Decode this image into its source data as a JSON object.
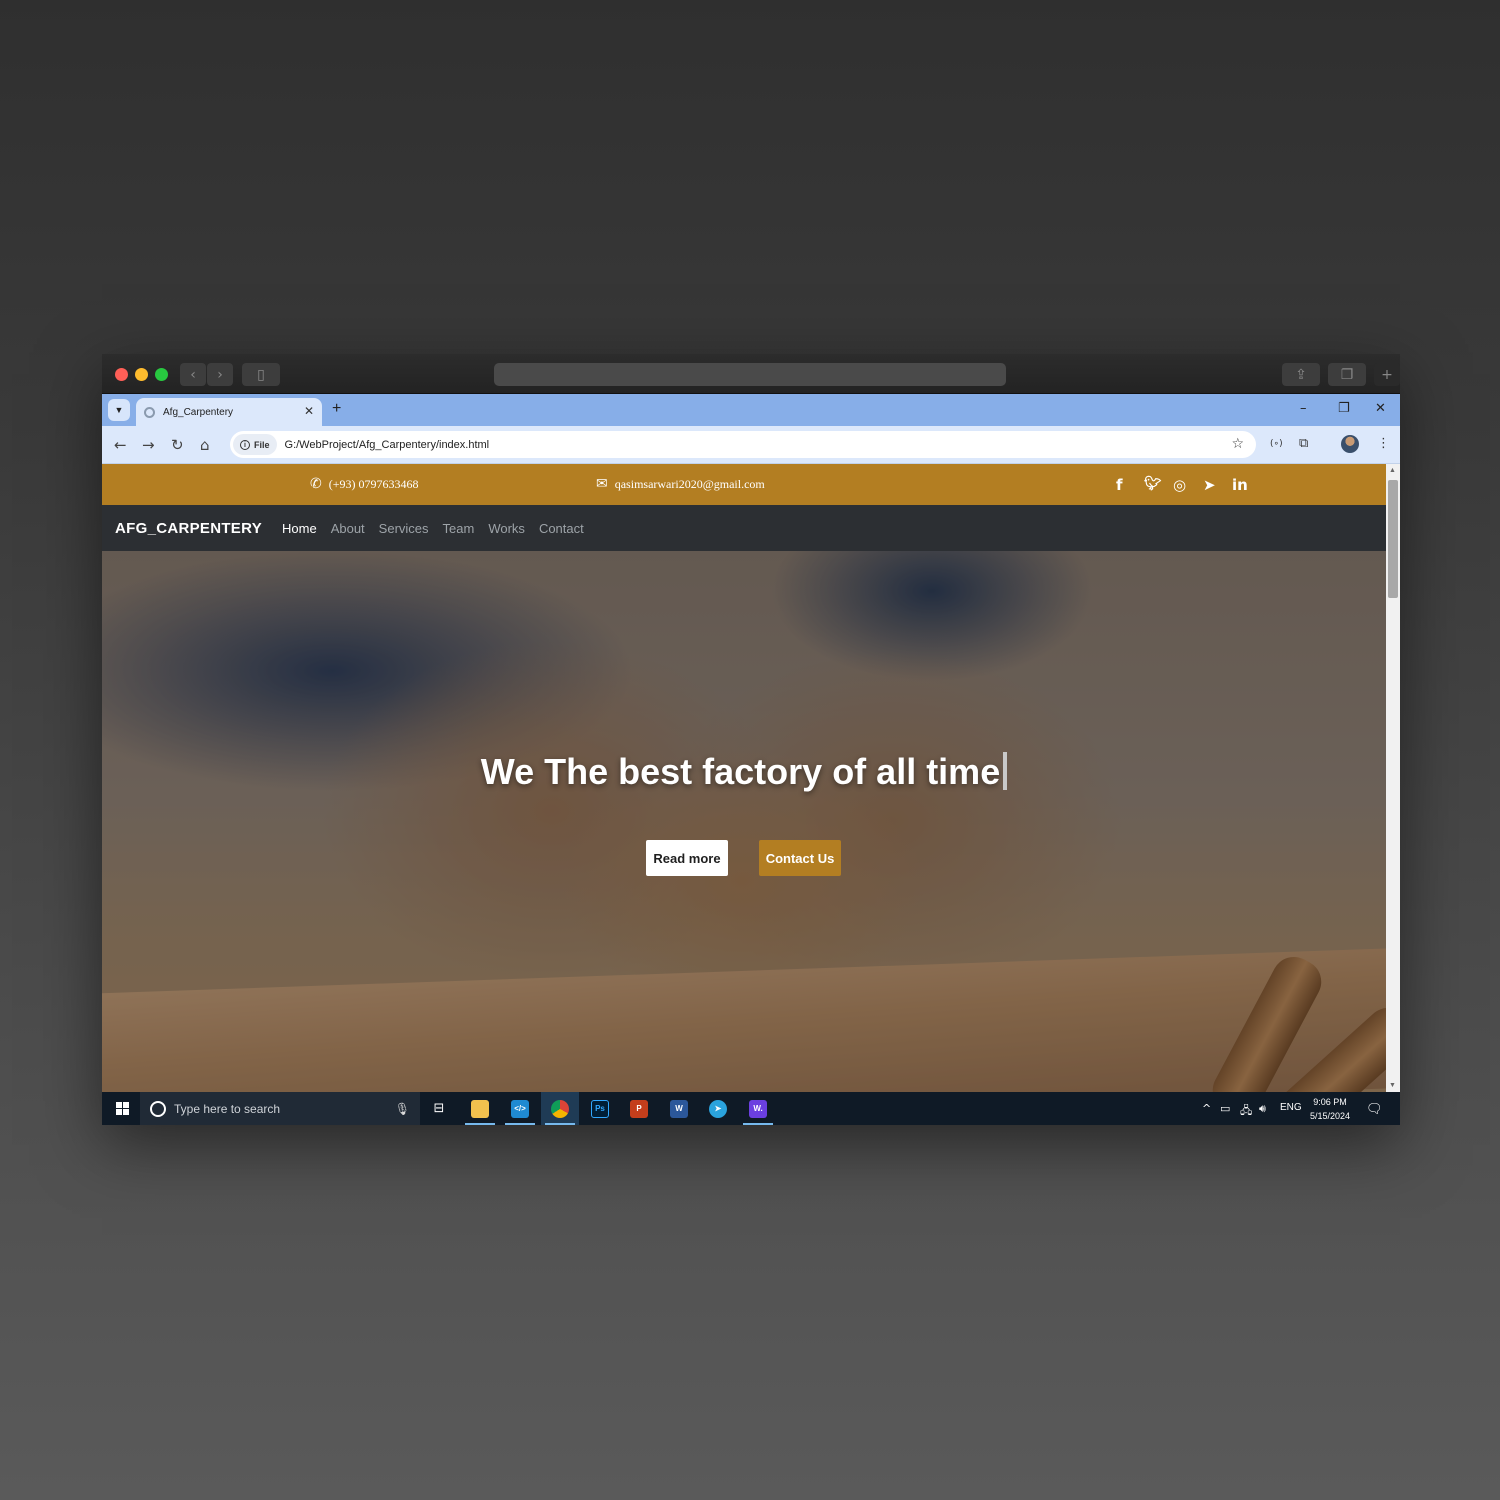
{
  "browser": {
    "tab_title": "Afg_Carpentery",
    "url_chip": "File",
    "url": "G:/WebProject/Afg_Carpentery/index.html"
  },
  "site": {
    "phone": "(+93) 0797633468",
    "email": "qasimsarwari2020@gmail.com",
    "social_icons": [
      "facebook-icon",
      "twitter-icon",
      "instagram-icon",
      "telegram-icon",
      "linkedin-icon"
    ],
    "brand": "AFG_CARPENTERY",
    "nav": [
      {
        "label": "Home",
        "active": true
      },
      {
        "label": "About",
        "active": false
      },
      {
        "label": "Services",
        "active": false
      },
      {
        "label": "Team",
        "active": false
      },
      {
        "label": "Works",
        "active": false
      },
      {
        "label": "Contact",
        "active": false
      }
    ],
    "hero_title": "We The best factory of all time",
    "read_more_label": "Read more",
    "contact_label": "Contact Us",
    "accent_color": "#b37e22"
  },
  "taskbar": {
    "search_placeholder": "Type here to search",
    "apps": [
      "task-view",
      "file-explorer",
      "vs-code",
      "chrome",
      "photoshop",
      "powerpoint",
      "word",
      "telegram",
      "other-app"
    ],
    "language": "ENG",
    "time": "9:06 PM",
    "date": "5/15/2024"
  }
}
